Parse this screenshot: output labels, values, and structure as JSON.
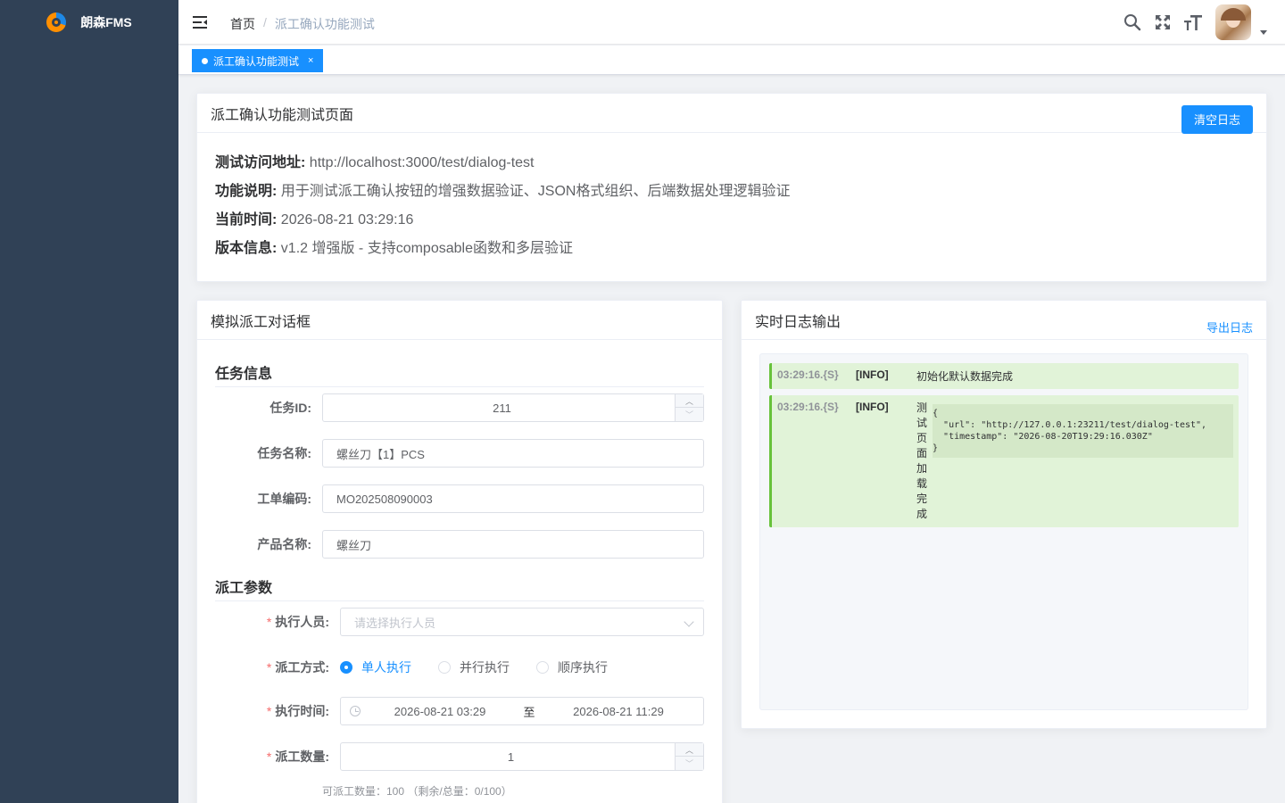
{
  "app": {
    "title": "朗森FMS"
  },
  "breadcrumb": {
    "home": "首页",
    "separator": "/",
    "current": "派工确认功能测试"
  },
  "tags": {
    "active": "派工确认功能测试",
    "close": "×"
  },
  "icons": {
    "search": "search-icon",
    "fullscreen": "fullscreen-icon",
    "font_size": "font-size-icon",
    "menu": "hamburger-icon"
  },
  "info_card": {
    "title": "派工确认功能测试页面",
    "clear_button": "清空日志",
    "lines": [
      {
        "label": "测试访问地址:",
        "value": " http://localhost:3000/test/dialog-test"
      },
      {
        "label": "功能说明:",
        "value": " 用于测试派工确认按钮的增强数据验证、JSON格式组织、后端数据处理逻辑验证"
      },
      {
        "label": "当前时间:",
        "value": " 2026-08-21 03:29:16"
      },
      {
        "label": "版本信息:",
        "value": " v1.2 增强版 - 支持composable函数和多层验证"
      }
    ]
  },
  "dialog_card": {
    "title": "模拟派工对话框",
    "task_section": "任务信息",
    "task_id": {
      "label": "任务ID:",
      "value": "211"
    },
    "task_name": {
      "label": "任务名称:",
      "value": "螺丝刀【1】PCS"
    },
    "work_order": {
      "label": "工单编码:",
      "value": "MO202508090003"
    },
    "product_name": {
      "label": "产品名称:",
      "value": "螺丝刀"
    },
    "dispatch_section": "派工参数",
    "executor": {
      "label": "执行人员:",
      "placeholder": "请选择执行人员"
    },
    "dispatch_mode": {
      "label": "派工方式:",
      "options": [
        "单人执行",
        "并行执行",
        "顺序执行"
      ],
      "selected": "单人执行"
    },
    "exec_time": {
      "label": "执行时间:",
      "start": "2026-08-21 03:29",
      "separator": "至",
      "end": "2026-08-21 11:29"
    },
    "dispatch_qty": {
      "label": "派工数量:",
      "value": "1"
    },
    "qty_hint": "可派工数量：100 （剩余/总量：0/100）",
    "required_mark": "*"
  },
  "log_card": {
    "title": "实时日志输出",
    "export_link": "导出日志",
    "entries": [
      {
        "time": "03:29:16.{S}",
        "level": "[INFO]",
        "message": "初始化默认数据完成",
        "json": ""
      },
      {
        "time": "03:29:16.{S}",
        "level": "[INFO]",
        "message": "测试页面加载完成",
        "json": "{\n  \"url\": \"http://127.0.0.1:23211/test/dialog-test\",\n  \"timestamp\": \"2026-08-20T19:29:16.030Z\"\n}"
      }
    ]
  },
  "colors": {
    "primary": "#1890ff",
    "sidebar": "#304156",
    "log_bg": "#e1f3d8",
    "log_border": "#67c23a",
    "required": "#f56c6c"
  }
}
